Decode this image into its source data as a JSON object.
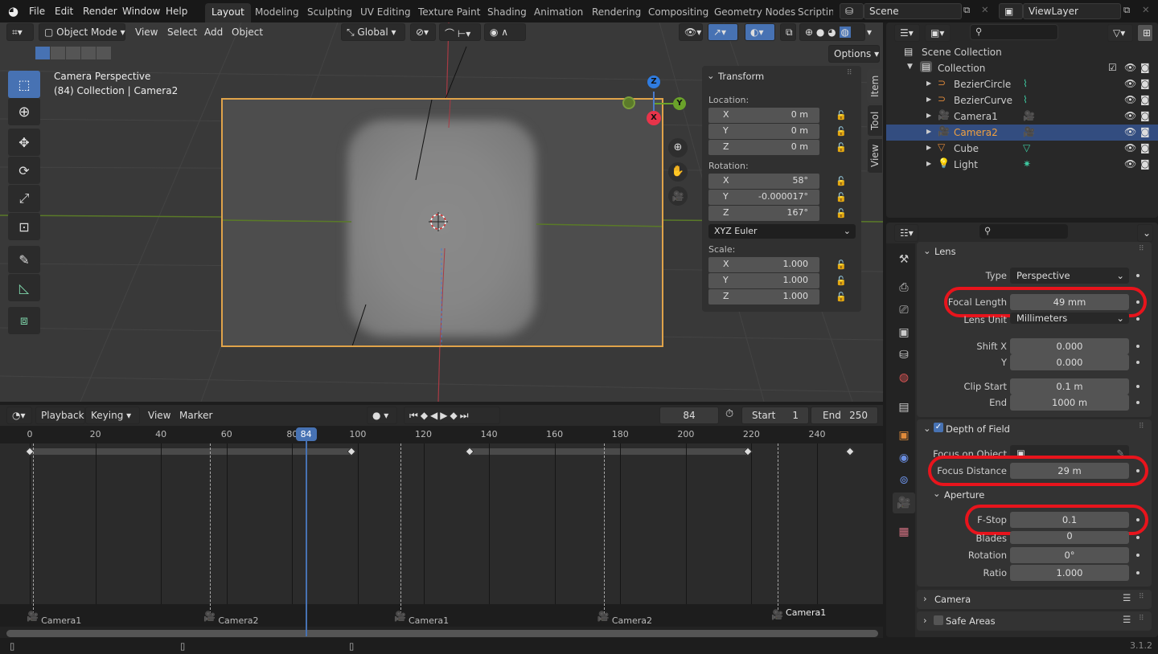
{
  "topbar": {
    "menus": [
      "File",
      "Edit",
      "Render",
      "Window",
      "Help"
    ],
    "workspaces": [
      "Layout",
      "Modeling",
      "Sculpting",
      "UV Editing",
      "Texture Paint",
      "Shading",
      "Animation",
      "Rendering",
      "Compositing",
      "Geometry Nodes",
      "Scripting"
    ],
    "active_workspace": "Layout",
    "scene": "Scene",
    "view_layer": "ViewLayer"
  },
  "viewport": {
    "mode": "Object Mode",
    "menus": [
      "View",
      "Select",
      "Add",
      "Object"
    ],
    "orientation": "Global",
    "options_label": "Options",
    "overlay_title": "Camera Perspective",
    "overlay_subtitle": "(84) Collection | Camera2",
    "gizmo": {
      "x": "X",
      "y": "Y",
      "z": "Z"
    }
  },
  "npanel": {
    "title": "Transform",
    "location_label": "Location:",
    "location": [
      {
        "axis": "X",
        "value": "0 m"
      },
      {
        "axis": "Y",
        "value": "0 m"
      },
      {
        "axis": "Z",
        "value": "0 m"
      }
    ],
    "rotation_label": "Rotation:",
    "rotation": [
      {
        "axis": "X",
        "value": "58°"
      },
      {
        "axis": "Y",
        "value": "-0.000017°"
      },
      {
        "axis": "Z",
        "value": "167°"
      }
    ],
    "rotation_mode": "XYZ Euler",
    "scale_label": "Scale:",
    "scale": [
      {
        "axis": "X",
        "value": "1.000"
      },
      {
        "axis": "Y",
        "value": "1.000"
      },
      {
        "axis": "Z",
        "value": "1.000"
      }
    ],
    "tabs": [
      "Item",
      "Tool",
      "View"
    ]
  },
  "outliner": {
    "root": "Scene Collection",
    "collection": "Collection",
    "items": [
      {
        "name": "BezierCircle",
        "selected": false
      },
      {
        "name": "BezierCurve",
        "selected": false
      },
      {
        "name": "Camera1",
        "selected": false
      },
      {
        "name": "Camera2",
        "selected": true
      },
      {
        "name": "Cube",
        "selected": false
      },
      {
        "name": "Light",
        "selected": false
      }
    ]
  },
  "properties": {
    "lens": {
      "title": "Lens",
      "type_label": "Type",
      "type_value": "Perspective",
      "focal_label": "Focal Length",
      "focal_value": "49 mm",
      "unit_label": "Lens Unit",
      "unit_value": "Millimeters",
      "shiftx_label": "Shift X",
      "shiftx_value": "0.000",
      "shifty_label": "Y",
      "shifty_value": "0.000",
      "clipstart_label": "Clip Start",
      "clipstart_value": "0.1 m",
      "clipend_label": "End",
      "clipend_value": "1000 m"
    },
    "dof": {
      "title": "Depth of Field",
      "enabled": true,
      "focus_obj_label": "Focus on Object",
      "focus_dist_label": "Focus Distance",
      "focus_dist_value": "29 m",
      "aperture_title": "Aperture",
      "fstop_label": "F-Stop",
      "fstop_value": "0.1",
      "blades_label": "Blades",
      "blades_value": "0",
      "rotation_label": "Rotation",
      "rotation_value": "0°",
      "ratio_label": "Ratio",
      "ratio_value": "1.000"
    },
    "camera_title": "Camera",
    "safe_areas_title": "Safe Areas"
  },
  "timeline": {
    "menus": [
      "Playback",
      "Keying",
      "View",
      "Marker"
    ],
    "current_frame": "84",
    "start_label": "Start",
    "start": "1",
    "end_label": "End",
    "end": "250",
    "ticks": [
      "0",
      "20",
      "40",
      "60",
      "80",
      "100",
      "120",
      "140",
      "160",
      "180",
      "200",
      "220",
      "240"
    ],
    "markers": [
      {
        "label": "Camera1",
        "frame": 1
      },
      {
        "label": "Camera2",
        "frame": 55
      },
      {
        "label": "Camera1",
        "frame": 113
      },
      {
        "label": "Camera2",
        "frame": 175
      },
      {
        "label": "Camera1",
        "frame": 228
      }
    ],
    "keyframes": [
      0,
      98,
      134,
      219,
      250
    ]
  },
  "status": {
    "version": "3.1.2"
  }
}
